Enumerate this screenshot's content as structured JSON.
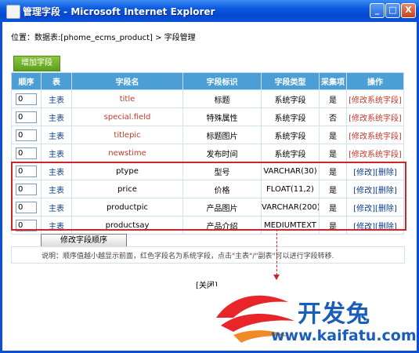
{
  "window": {
    "title": "管理字段 - Microsoft Internet Explorer",
    "min_label": "_",
    "max_label": "□",
    "close_label": "X"
  },
  "breadcrumb": {
    "prefix": "位置：",
    "table_link": "数据表:[phome_ecms_product]",
    "separator": " > ",
    "current": "字段管理"
  },
  "add_field_button": "增加字段",
  "table": {
    "headers": [
      "顺序",
      "表",
      "字段名",
      "字段标识",
      "字段类型",
      "采集项",
      "操作"
    ],
    "rows": [
      {
        "order": "0",
        "table": "主表",
        "name": "title",
        "label": "标题",
        "type": "系统字段",
        "collect": "是",
        "op1": "[修改系统字段]",
        "op2": ""
      },
      {
        "order": "0",
        "table": "主表",
        "name": "special.field",
        "label": "特殊属性",
        "type": "系统字段",
        "collect": "否",
        "op1": "[修改系统字段]",
        "op2": ""
      },
      {
        "order": "0",
        "table": "主表",
        "name": "titlepic",
        "label": "标题图片",
        "type": "系统字段",
        "collect": "是",
        "op1": "[修改系统字段]",
        "op2": ""
      },
      {
        "order": "0",
        "table": "主表",
        "name": "newstime",
        "label": "发布时间",
        "type": "系统字段",
        "collect": "是",
        "op1": "[修改系统字段]",
        "op2": ""
      },
      {
        "order": "0",
        "table": "主表",
        "name": "ptype",
        "label": "型号",
        "type": "VARCHAR(30)",
        "collect": "是",
        "op1": "[修改]",
        "op2": "[删除]"
      },
      {
        "order": "0",
        "table": "主表",
        "name": "price",
        "label": "价格",
        "type": "FLOAT(11,2)",
        "collect": "是",
        "op1": "[修改]",
        "op2": "[删除]"
      },
      {
        "order": "0",
        "table": "主表",
        "name": "productpic",
        "label": "产品图片",
        "type": "VARCHAR(200)",
        "collect": "是",
        "op1": "[修改]",
        "op2": "[删除]"
      },
      {
        "order": "0",
        "table": "主表",
        "name": "productsay",
        "label": "产品介绍",
        "type": "MEDIUMTEXT",
        "collect": "是",
        "op1": "[修改]",
        "op2": "[删除]"
      }
    ]
  },
  "save_order_button": "修改字段顺序",
  "note": "说明：顺序值越小越显示前面，红色字段名为系统字段，点击\"主表\"/\"副表\"可以进行字段转移.",
  "close_link": "[关闭]",
  "watermark": {
    "brand": "开发兔",
    "url": "www.kaifatu.com"
  },
  "colors": {
    "header_bg": "#4c9fd6",
    "system_field": "#c0392b",
    "highlight_box": "#c8282c",
    "add_button": "#6aac24"
  }
}
